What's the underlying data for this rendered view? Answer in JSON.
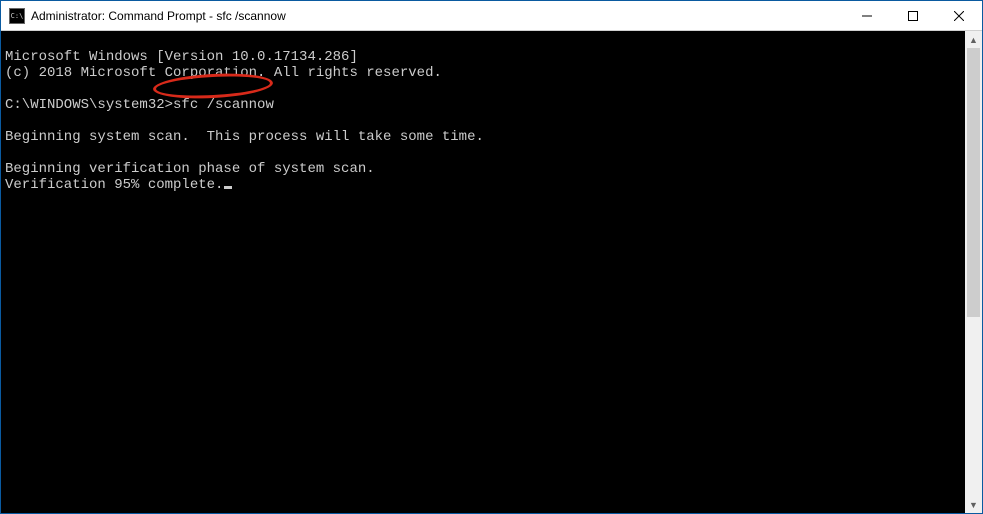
{
  "titlebar": {
    "icon_label": "C:\\",
    "title": "Administrator: Command Prompt - sfc  /scannow"
  },
  "window_controls": {
    "minimize": "Minimize",
    "maximize": "Maximize",
    "close": "Close"
  },
  "console": {
    "line1": "Microsoft Windows [Version 10.0.17134.286]",
    "line2": "(c) 2018 Microsoft Corporation. All rights reserved.",
    "blank1": "",
    "prompt_prefix": "C:\\WINDOWS\\system32>",
    "prompt_command": "sfc /scannow",
    "blank2": "",
    "line3": "Beginning system scan.  This process will take some time.",
    "blank3": "",
    "line4": "Beginning verification phase of system scan.",
    "line5": "Verification 95% complete."
  },
  "annotation": {
    "target": "sfc /scannow",
    "color": "#d82a1a"
  },
  "scrollbar": {
    "up": "▲",
    "down": "▼"
  }
}
